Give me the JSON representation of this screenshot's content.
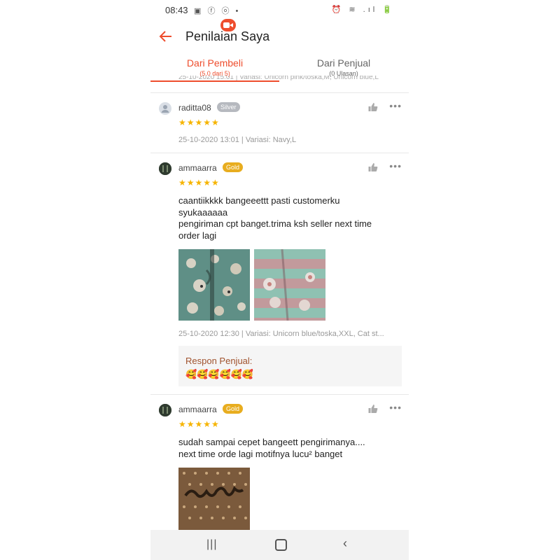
{
  "status_bar": {
    "time": "08:43",
    "left_icons": "▣ ⓕ ⓞ •",
    "right_icons": "⏰ ≋ .ıl 🔋"
  },
  "header": {
    "title": "Penilaian Saya",
    "back_icon": "arrow-left-icon",
    "recording_icon": "video-record-icon"
  },
  "tabs": [
    {
      "label": "Dari Pembeli",
      "sub": "(5.0 dari 5)",
      "active": true
    },
    {
      "label": "Dari Penjual",
      "sub": "(0 Ulasan)",
      "active": false
    }
  ],
  "cutoff_text": "25-10-2020 15:01 | Variasi: Unicorn pink/toska,M, Unicorn blue,L",
  "reviews": [
    {
      "username": "raditta08",
      "badge": "Silver",
      "stars": "★★★★★",
      "text": "",
      "meta": "25-10-2020 13:01 | Variasi: Navy,L"
    },
    {
      "username": "ammaarra",
      "badge": "Gold",
      "stars": "★★★★★",
      "text_lines": [
        "caantiikkkk bangeeettt pasti customerku",
        "syukaaaaaa",
        "pengiriman cpt banget.trima ksh seller next time",
        "order lagi"
      ],
      "meta": "25-10-2020 12:30 | Variasi: Unicorn blue/toska,XXL, Cat st...",
      "seller_response": {
        "label": "Respon Penjual:",
        "text": "🥰🥰🥰🥰🥰🥰"
      }
    },
    {
      "username": "ammaarra",
      "badge": "Gold",
      "stars": "★★★★★",
      "text_lines": [
        "sudah sampai cepet bangeett pengirimanya....",
        "next time orde lagi motifnya lucu² banget"
      ]
    }
  ],
  "colors": {
    "accent": "#ee4d2d",
    "star": "#f6b400",
    "gold_badge": "#e8ad1f",
    "silver_badge": "#b6b9bf"
  },
  "nav": {
    "recent": "|||",
    "back": "‹"
  }
}
